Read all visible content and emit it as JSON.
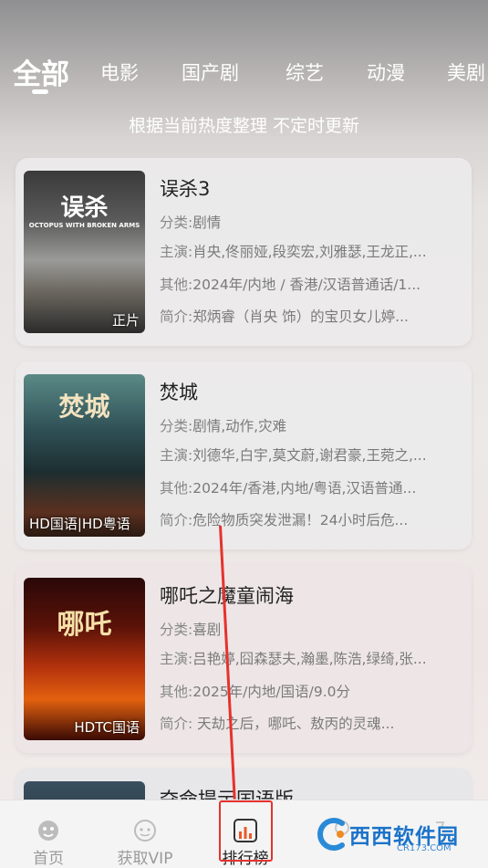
{
  "tabs": [
    {
      "label": "全部",
      "active": true
    },
    {
      "label": "电影"
    },
    {
      "label": "国产剧"
    },
    {
      "label": "综艺"
    },
    {
      "label": "动漫"
    },
    {
      "label": "美剧"
    }
  ],
  "subtitle": "根据当前热度整理 不定时更新",
  "labels": {
    "category": "分类:",
    "cast": "主演:",
    "other": "其他:",
    "intro": "简介:"
  },
  "cards": [
    {
      "title": "误杀3",
      "category": "剧情",
      "cast": "肖央,佟丽娅,段奕宏,刘雅瑟,王龙正,...",
      "other": "2024年/内地 / 香港/汉语普通话/1...",
      "intro": "郑炳睿（肖央 饰）的宝贝女儿婷...",
      "badge": "正片",
      "poster_title": "误杀",
      "poster_sub": "OCTOPUS WITH BROKEN ARMS"
    },
    {
      "title": "焚城",
      "category": "剧情,动作,灾难",
      "cast": "刘德华,白宇,莫文蔚,谢君豪,王菀之,...",
      "other": "2024年/香港,内地/粤语,汉语普通...",
      "intro": "危险物质突发泄漏！24小时后危...",
      "badge": "HD国语|HD粤语",
      "poster_title": "焚城"
    },
    {
      "title": "哪吒之魔童闹海",
      "category": "喜剧",
      "cast": "吕艳婷,囧森瑟夫,瀚墨,陈浩,绿绮,张...",
      "other": "2025年/内地/国语/9.0分",
      "intro": "    天劫之后，哪吒、敖丙的灵魂...",
      "badge": "HDTC国语",
      "poster_title": "哪吒"
    },
    {
      "title": "夺命提示国语版"
    }
  ],
  "nav": [
    {
      "label": "首页",
      "icon": "home-icon"
    },
    {
      "label": "获取VIP",
      "icon": "vip-icon"
    },
    {
      "label": "排行榜",
      "icon": "ranking-icon",
      "active": true
    },
    {
      "label": "",
      "icon": "message-icon"
    },
    {
      "label": "",
      "icon": "profile-icon"
    }
  ],
  "watermark": {
    "text": "西西软件园",
    "sub": "CR173.COM"
  },
  "colors": {
    "highlight": "#e6322e",
    "tab_text": "#ffffff",
    "watermark": "#1b73c9"
  }
}
